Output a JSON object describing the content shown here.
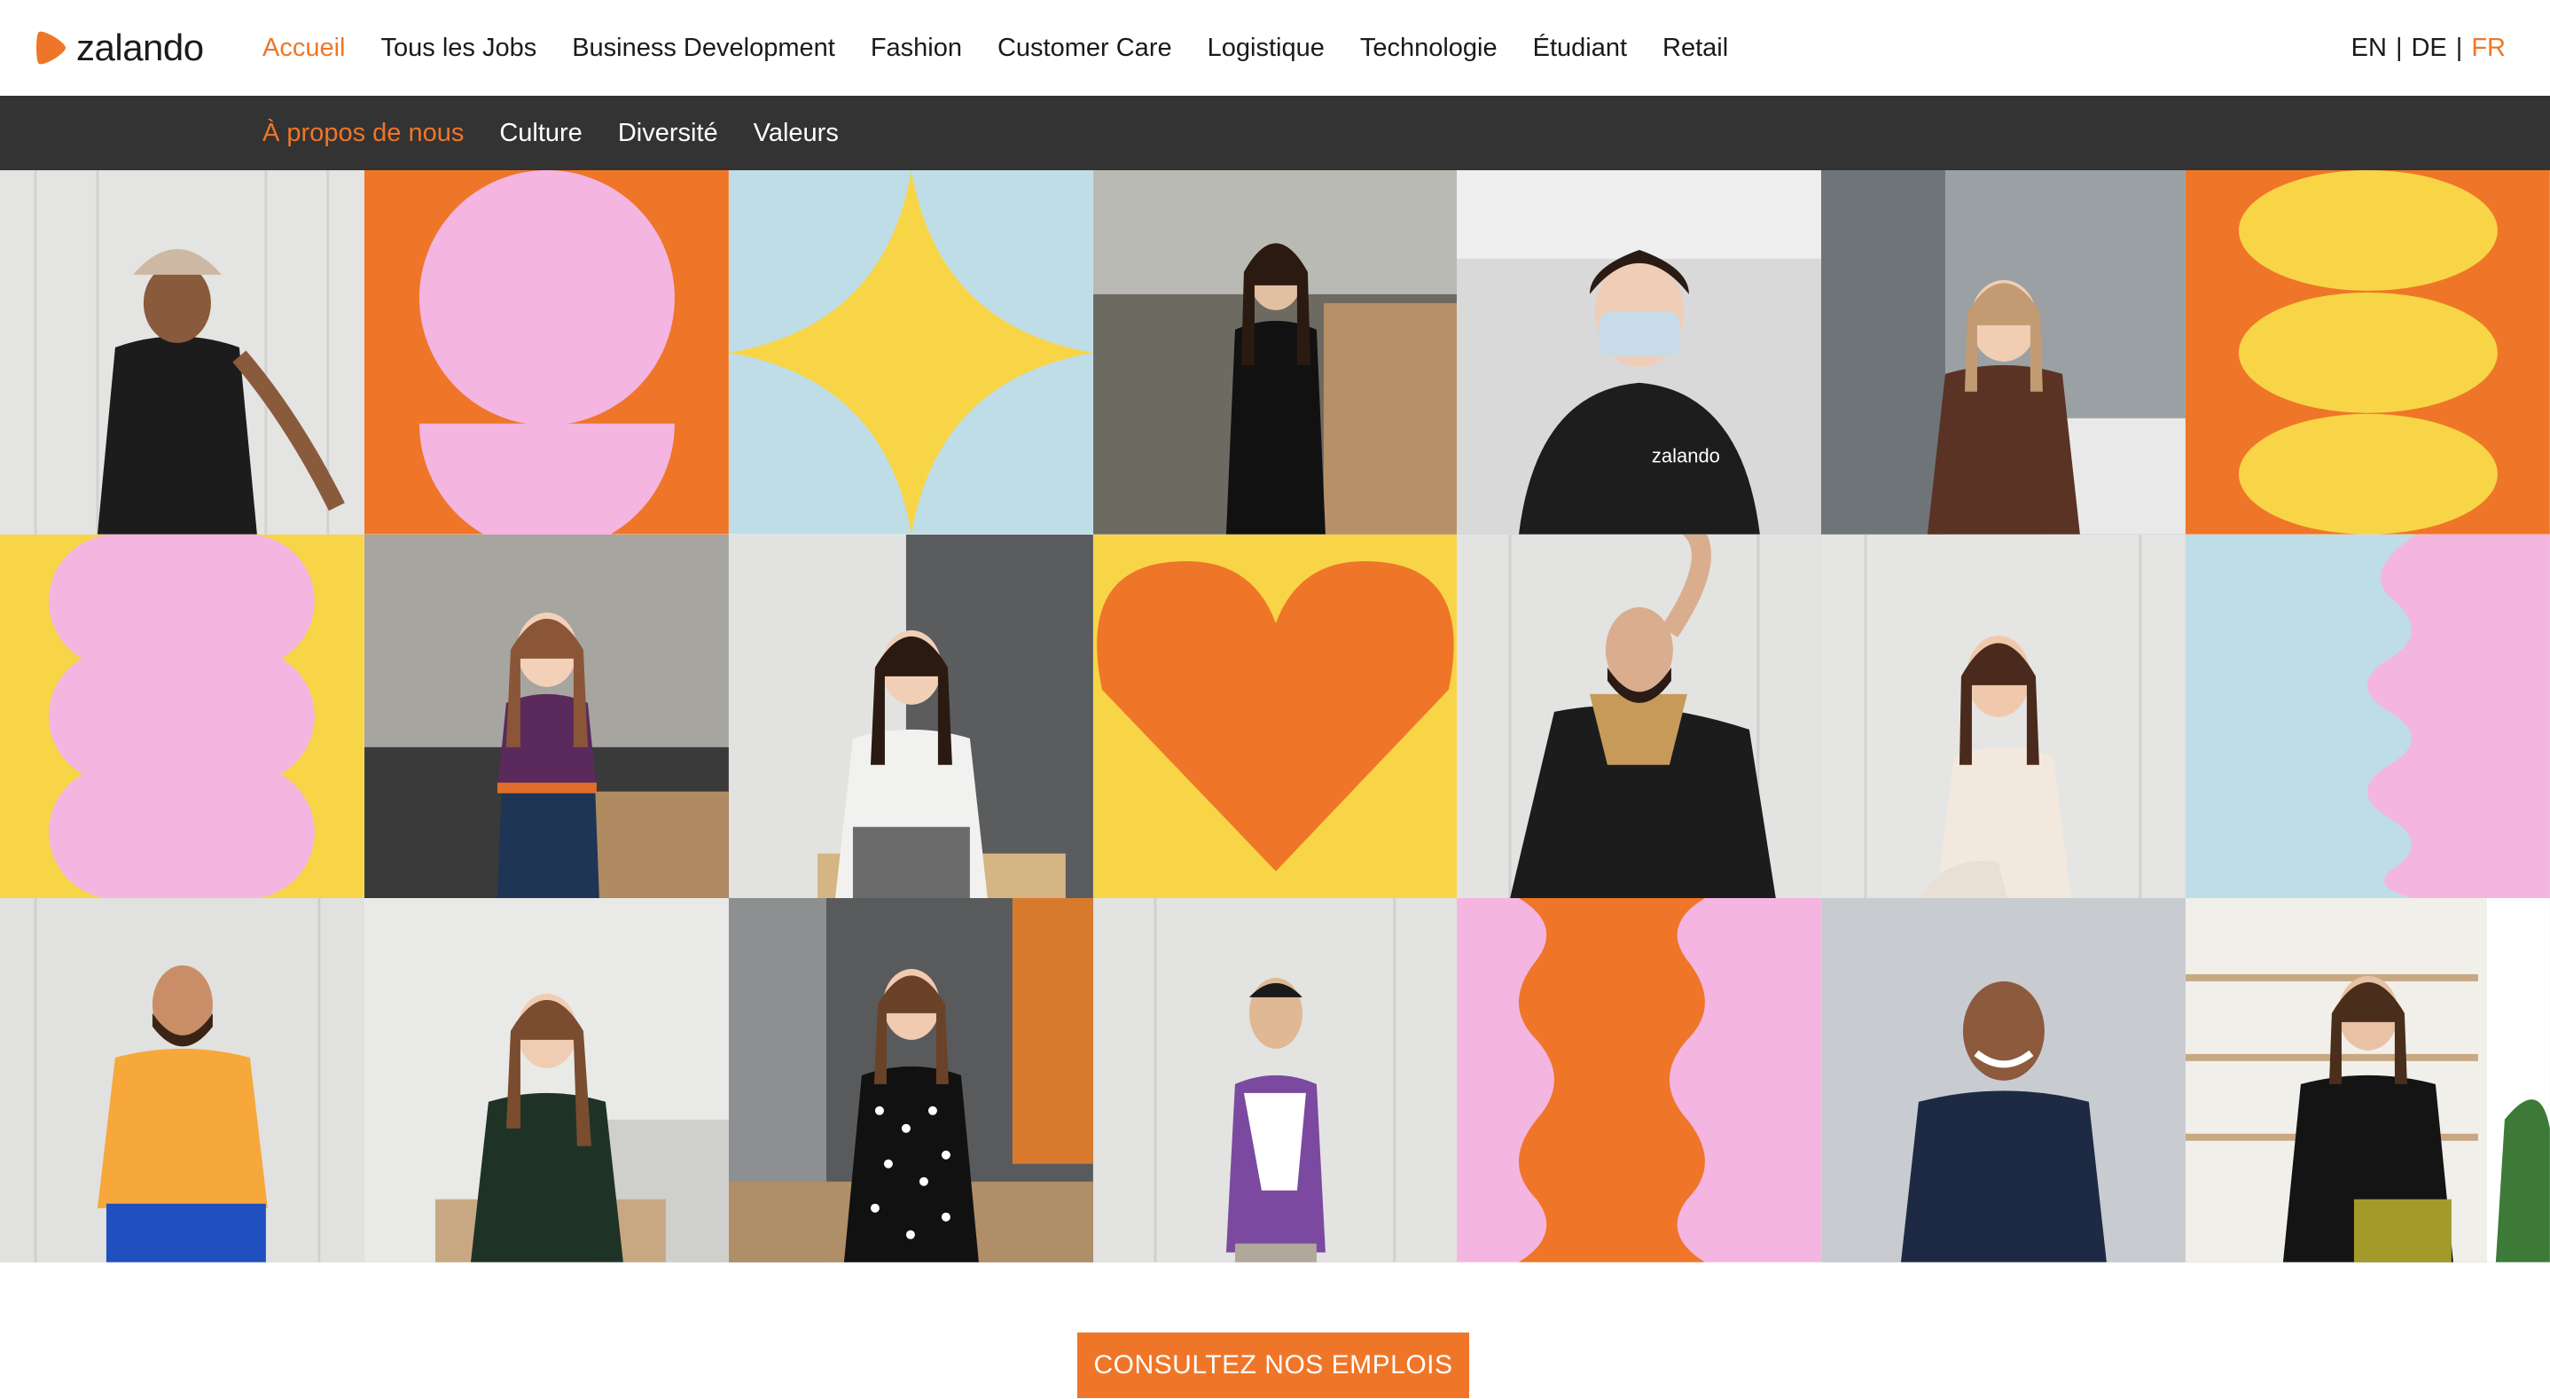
{
  "brand": {
    "name": "zalando",
    "accent": "#ef7628"
  },
  "nav": {
    "items": [
      {
        "label": "Accueil",
        "active": true
      },
      {
        "label": "Tous les Jobs"
      },
      {
        "label": "Business Development"
      },
      {
        "label": "Fashion"
      },
      {
        "label": "Customer Care"
      },
      {
        "label": "Logistique"
      },
      {
        "label": "Technologie"
      },
      {
        "label": "Étudiant"
      },
      {
        "label": "Retail"
      }
    ]
  },
  "languages": {
    "en": "EN",
    "de": "DE",
    "fr": "FR",
    "separator": "|",
    "active": "FR"
  },
  "subnav": {
    "items": [
      {
        "label": "À propos de nous",
        "active": true
      },
      {
        "label": "Culture"
      },
      {
        "label": "Diversité"
      },
      {
        "label": "Valeurs"
      }
    ]
  },
  "logos": {
    "sweatshirt_logo": "zalando"
  },
  "colors": {
    "orange": "#ef7628",
    "pink": "#f4b5e1",
    "yellow": "#f7d547",
    "lightblue": "#bfdde6",
    "dark": "#333333"
  },
  "cta": {
    "label": "CONSULTEZ NOS EMPLOIS"
  }
}
